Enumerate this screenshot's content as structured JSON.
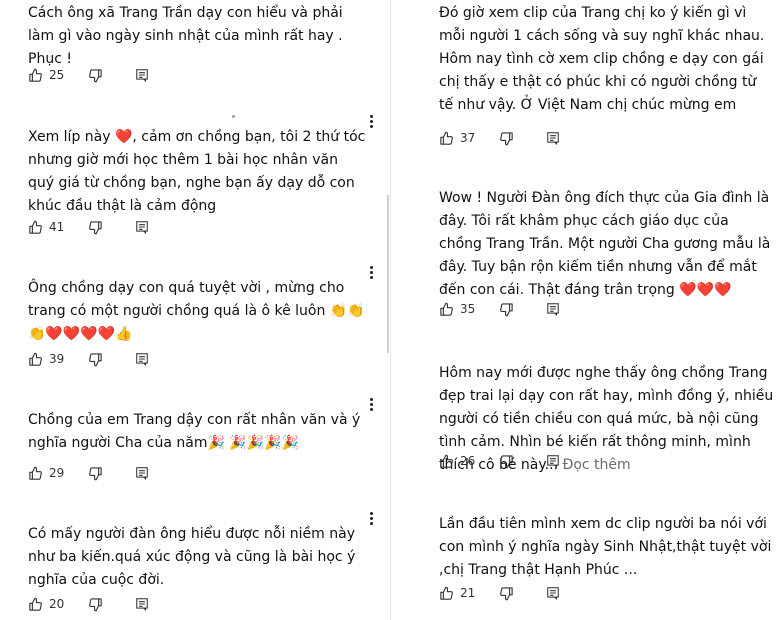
{
  "comments_left": [
    {
      "text": "Cách ông xã Trang Trần dạy con hiểu và  phải  làm gì vào ngày sinh nhật của mình rất hay . Phục !",
      "likes": "25"
    },
    {
      "text": "Xem líp này ❤️, cảm ơn chồng bạn, tôi 2 thứ tóc nhưng giờ mới học thêm 1 bài học nhân văn quý giá từ chồng bạn, nghe bạn ấy dạy dỗ con khúc đầu thật là cảm động",
      "likes": "41"
    },
    {
      "text": "Ông chồng dạy con quá tuyệt vời , mừng cho trang có một người chồng quá là ô kê luôn 👏👏👏❤️❤️❤️❤️👍",
      "likes": "39"
    },
    {
      "text": "Chồng của em Trang dậy con rất nhân văn và ý nghĩa người Cha của năm🎉 🎉🎉🎉🎉",
      "likes": "29"
    },
    {
      "text": "Có mấy người đàn ông hiểu được nỗi niềm này như ba kiến.quá xúc động  và cũng là bài học ý nghĩa của cuộc đời.",
      "likes": "20"
    }
  ],
  "comments_right": [
    {
      "text": "Đó giờ xem clip của Trang chị ko ý kiến gì vì mỗi người 1 cách sống và suy nghĩ khác nhau. Hôm nay tình cờ xem clip chồng e dạy con gái chị thấy e thật có phúc khi có người chồng từ tế như vậy. Ở Việt Nam chị chúc mừng em",
      "likes": "37"
    },
    {
      "text": "Wow ! Người Đàn ông đích thực của Gia đình là đây. Tôi rất khâm phục cách giáo dục của chồng Trang Trần. Một người Cha gương mẫu là đây. Tuy bận rộn kiếm tiền nhưng vẫn để mắt đến con cái. Thật đáng trân trọng ❤️❤️❤️",
      "likes": "35"
    },
    {
      "text": "Hôm nay mới được nghe thấy ông chồng Trang đẹp trai lại dạy con rất hay, mình đồng ý, nhiều người có tiền chiều con quá mức, bà nội cũng tình cảm. Nhìn bé kiến rất thông minh, mình thích cô bé này...",
      "more": "Đọc thêm",
      "likes": "26"
    },
    {
      "text": "Lần đầu tiên mình xem dc clip người ba nói với con mình ý nghĩa ngày Sinh Nhật,thật tuyệt vời ,chị Trang thật Hạnh Phúc ...",
      "likes": "21"
    }
  ],
  "icons": {
    "like": "thumbs-up-icon",
    "dislike": "thumbs-down-icon",
    "reply": "reply-icon",
    "menu": "more-vert-icon"
  },
  "colors": {
    "text": "#111111",
    "icon": "#333333",
    "muted": "#6b6b6b"
  }
}
